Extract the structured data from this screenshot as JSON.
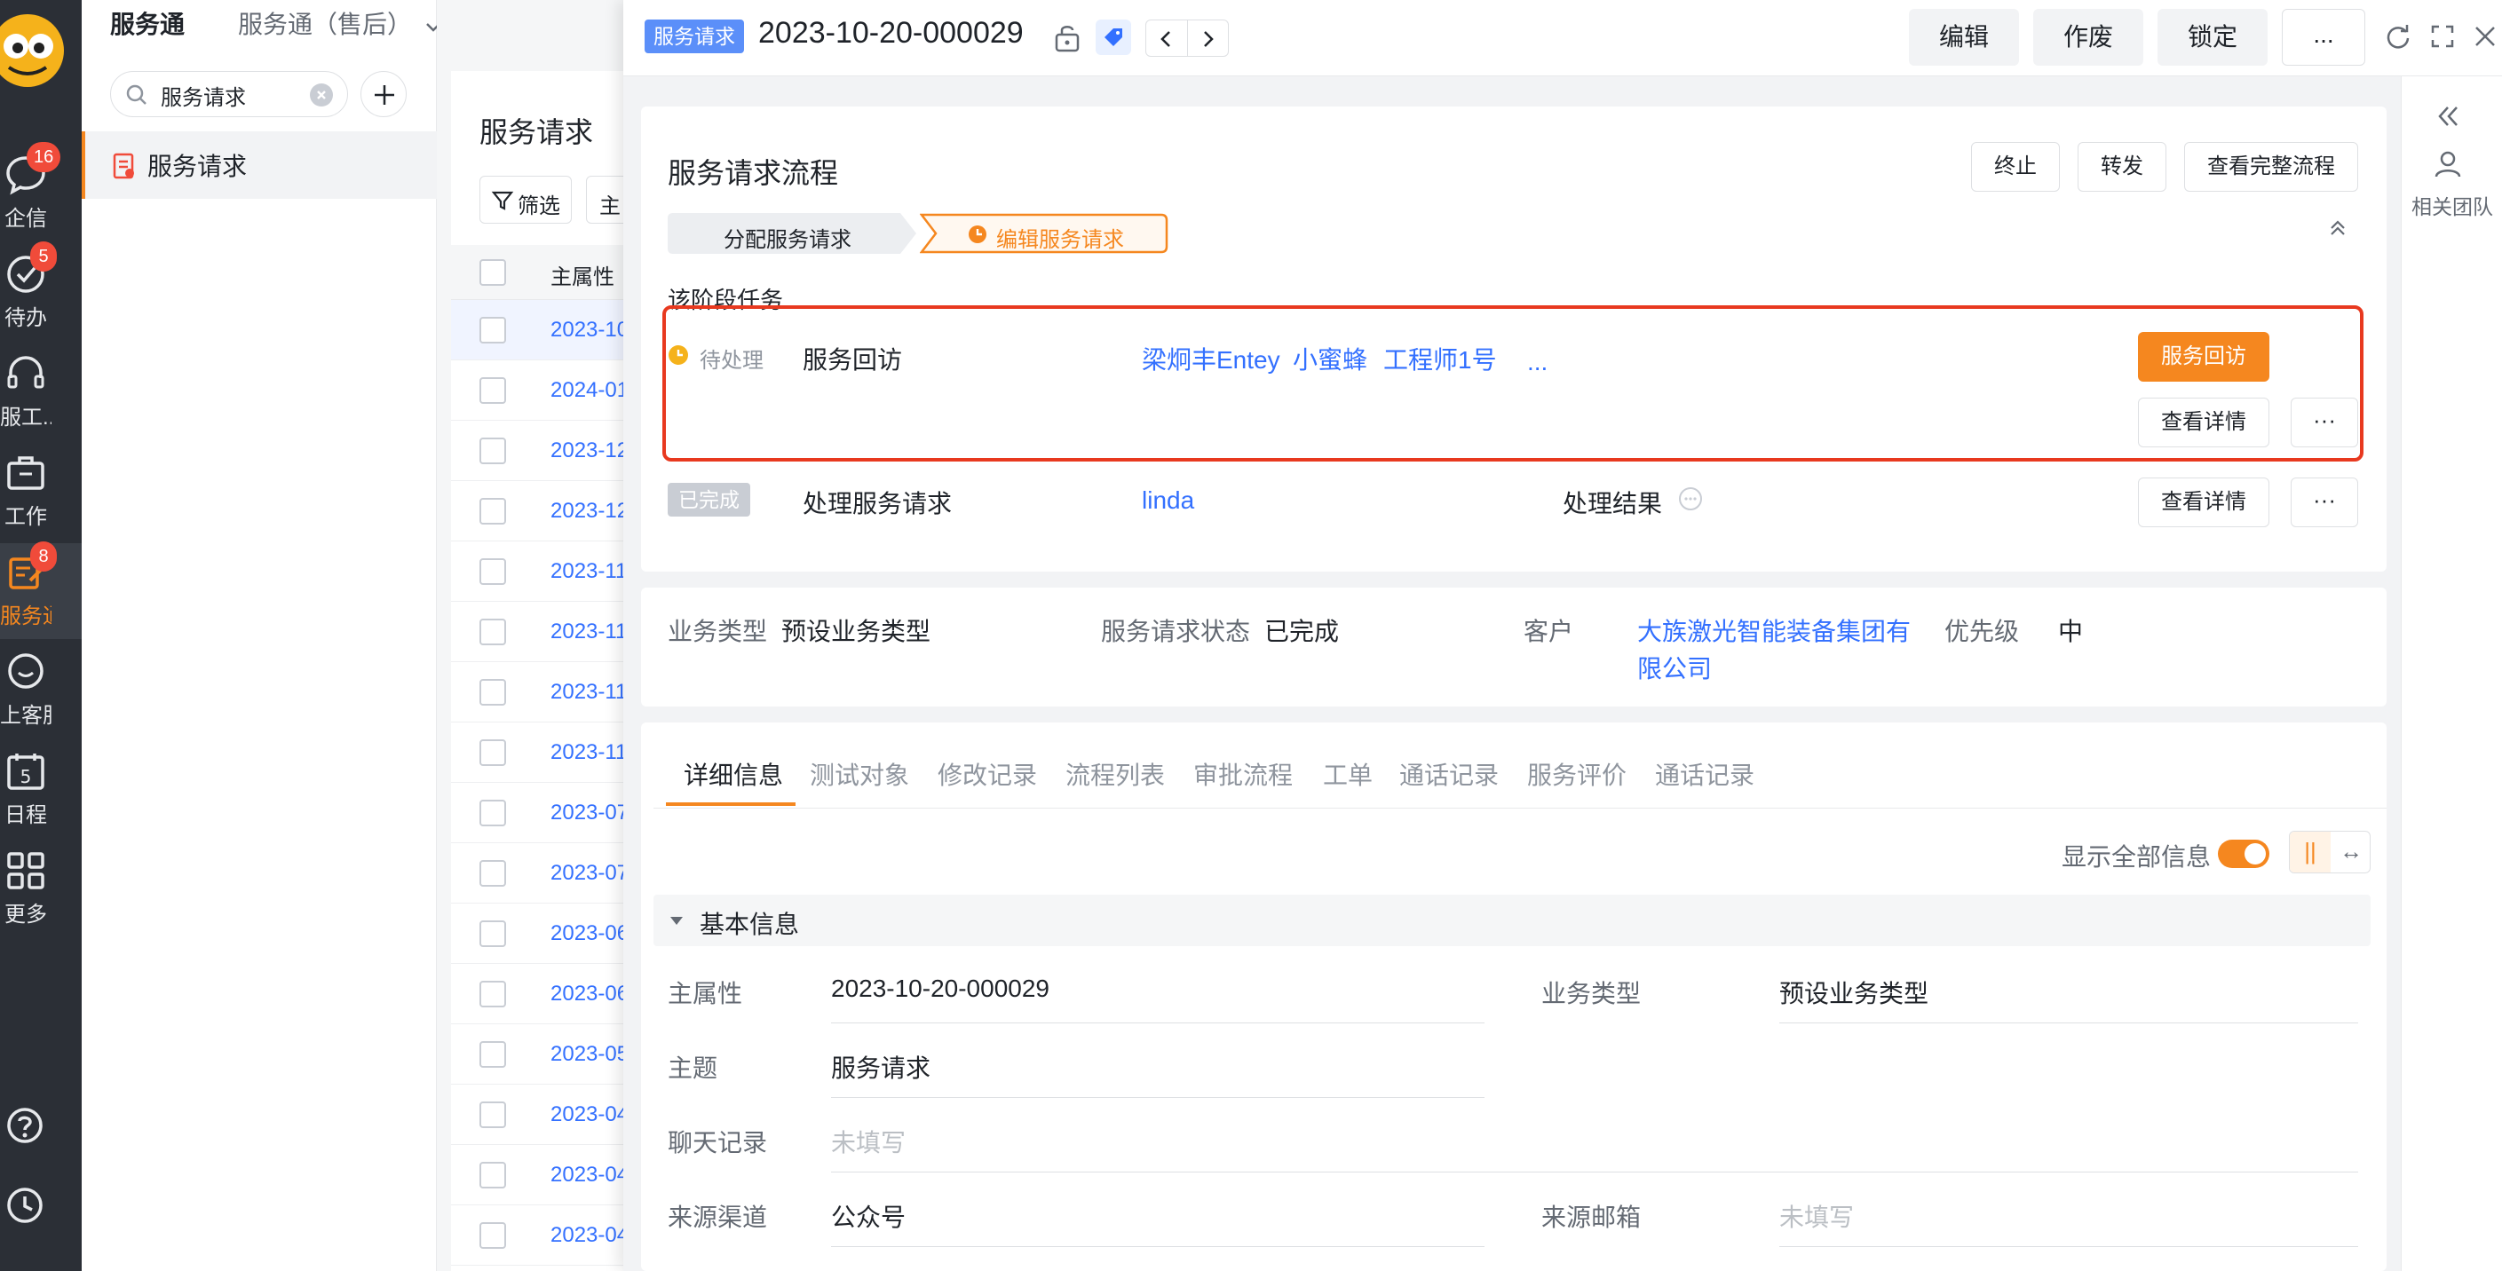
{
  "rail": {
    "items": [
      {
        "label": "企信",
        "badge": "16"
      },
      {
        "label": "待办",
        "badge": "5"
      },
      {
        "label": "服工...",
        "badge": ""
      },
      {
        "label": "工作",
        "badge": ""
      },
      {
        "label": "服务通",
        "badge": "8"
      },
      {
        "label": "上客服",
        "badge": ""
      },
      {
        "label": "日程",
        "badge": ""
      },
      {
        "label": "更多",
        "badge": ""
      }
    ],
    "calendar_day": "5"
  },
  "app_header": {
    "tab_a": "服务通",
    "tab_b": "服务通（售后）"
  },
  "search": {
    "value": "服务请求"
  },
  "nav": {
    "selected": "服务请求"
  },
  "list": {
    "title": "服务请求",
    "filter": "筛选",
    "main_btn": "主",
    "column": "主属性",
    "rows": [
      "2023-10",
      "2024-01",
      "2023-12",
      "2023-12",
      "2023-11",
      "2023-11",
      "2023-11",
      "2023-11",
      "2023-07",
      "2023-07",
      "2023-06",
      "2023-06",
      "2023-05",
      "2023-04",
      "2023-04",
      "2023-04"
    ]
  },
  "panel": {
    "tag": "服务请求",
    "title": "2023-10-20-000029",
    "buttons": {
      "edit": "编辑",
      "void": "作废",
      "lock": "锁定",
      "more": "..."
    }
  },
  "side": {
    "team": "相关团队"
  },
  "flow": {
    "title": "服务请求流程",
    "actions": {
      "terminate": "终止",
      "forward": "转发",
      "view_full": "查看完整流程"
    },
    "steps": [
      "分配服务请求",
      "编辑服务请求"
    ],
    "stage_label": "该阶段任务",
    "tasks": [
      {
        "status": "待处理",
        "name": "服务回访",
        "assignees": [
          "梁炯丰Entey",
          "小蜜蜂",
          "工程师1号"
        ],
        "more": "...",
        "primary": "服务回访",
        "detail": "查看详情",
        "dots": "···"
      },
      {
        "status": "已完成",
        "name": "处理服务请求",
        "assignees": [
          "linda"
        ],
        "result_label": "处理结果",
        "detail": "查看详情",
        "dots": "···"
      }
    ]
  },
  "summary": {
    "biz_type_k": "业务类型",
    "biz_type_v": "预设业务类型",
    "status_k": "服务请求状态",
    "status_v": "已完成",
    "customer_k": "客户",
    "customer_v1": "大族激光智能装备集团有",
    "customer_v2": "限公司",
    "priority_k": "优先级",
    "priority_v": "中"
  },
  "tabs": [
    "详细信息",
    "测试对象",
    "修改记录",
    "流程列表",
    "审批流程",
    "工单",
    "通话记录",
    "服务评价",
    "通话记录"
  ],
  "toggle": {
    "label": "显示全部信息",
    "on": true
  },
  "section": {
    "title": "基本信息"
  },
  "fields": {
    "main_k": "主属性",
    "main_v": "2023-10-20-000029",
    "biztype_k": "业务类型",
    "biztype_v": "预设业务类型",
    "subject_k": "主题",
    "subject_v": "服务请求",
    "chat_k": "聊天记录",
    "chat_v": "未填写",
    "channel_k": "来源渠道",
    "channel_v": "公众号",
    "email_k": "来源邮箱",
    "email_v": "未填写"
  },
  "colors": {
    "accent": "#f5871f",
    "link": "#3370ff",
    "highlight": "#e8391f",
    "rail": "#2b2f36"
  }
}
